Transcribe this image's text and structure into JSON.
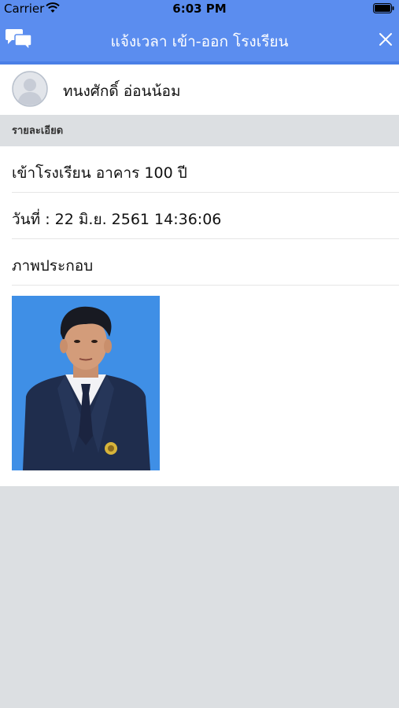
{
  "status_bar": {
    "carrier": "Carrier",
    "time": "6:03 PM"
  },
  "nav": {
    "title": "แจ้งเวลา เข้า-ออก โรงเรียน"
  },
  "profile": {
    "name": "ทนงศักดิ์ อ่อนน้อม"
  },
  "section": {
    "title": "รายละเอียด"
  },
  "details": {
    "location": "เข้าโรงเรียน อาคาร 100 ปี",
    "date": "วันที่ : 22 มิ.ย. 2561 14:36:06",
    "photo_label": "ภาพประกอบ"
  },
  "colors": {
    "nav_bg": "#5b8def",
    "page_bg": "#dcdfe2",
    "photo_bg": "#3f8fe6"
  },
  "icons": {
    "nav_left": "chat-bubbles-icon",
    "nav_right": "close-icon",
    "avatar": "default-avatar-icon"
  }
}
